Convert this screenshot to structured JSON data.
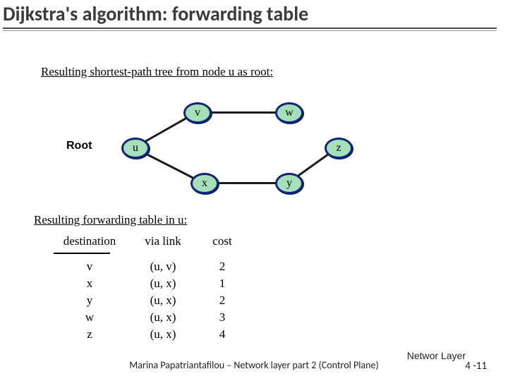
{
  "title": "Dijkstra's algorithm: forwarding table",
  "subhead_tree": "Resulting shortest-path tree from node u as root:",
  "subhead_table": "Resulting forwarding table in u:",
  "root_label": "Root",
  "nodes": {
    "u": "u",
    "v": "v",
    "w": "w",
    "x": "x",
    "y": "y",
    "z": "z"
  },
  "table": {
    "headers": {
      "dest": "destination",
      "link": "via link",
      "cost": "cost"
    },
    "rows": [
      {
        "dest": "v",
        "link": "(u, v)",
        "cost": "2"
      },
      {
        "dest": "x",
        "link": "(u, x)",
        "cost": "1"
      },
      {
        "dest": "y",
        "link": "(u, x)",
        "cost": "2"
      },
      {
        "dest": "w",
        "link": "(u, x)",
        "cost": "3"
      },
      {
        "dest": "z",
        "link": "(u, x)",
        "cost": "4"
      }
    ]
  },
  "footer": {
    "center": "Marina Papatriantafilou – Network layer part 2 (Control Plane)",
    "right_top": "Networ Layer",
    "right_bottom": "4 -11"
  },
  "chart_data": {
    "type": "table",
    "title": "Resulting forwarding table in u:",
    "columns": [
      "destination",
      "via link",
      "cost"
    ],
    "rows": [
      [
        "v",
        "(u, v)",
        2
      ],
      [
        "x",
        "(u, x)",
        1
      ],
      [
        "y",
        "(u, x)",
        2
      ],
      [
        "w",
        "(u, x)",
        3
      ],
      [
        "z",
        "(u, x)",
        4
      ]
    ],
    "tree": {
      "root": "u",
      "edges": [
        [
          "u",
          "v"
        ],
        [
          "u",
          "x"
        ],
        [
          "v",
          "w"
        ],
        [
          "x",
          "y"
        ],
        [
          "y",
          "z"
        ]
      ]
    }
  }
}
